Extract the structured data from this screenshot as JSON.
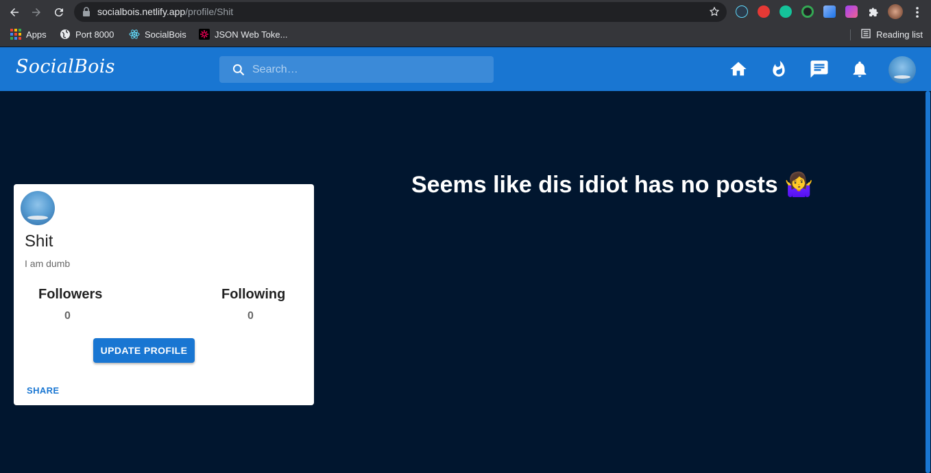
{
  "browser": {
    "url_host": "socialbois.netlify.app",
    "url_path": "/profile/Shit",
    "bookmarks": [
      "Apps",
      "Port 8000",
      "SocialBois",
      "JSON Web Toke..."
    ],
    "reading_list": "Reading list"
  },
  "appbar": {
    "brand": "SocialBois",
    "search_placeholder": "Search…",
    "nav_icons": [
      "home-icon",
      "fire-icon",
      "chat-icon",
      "bell-icon",
      "avatar"
    ],
    "color": "#1976d2"
  },
  "profile": {
    "name": "Shit",
    "bio": "I am dumb",
    "followers_label": "Followers",
    "followers_count": "0",
    "following_label": "Following",
    "following_count": "0",
    "update_button": "UPDATE PROFILE",
    "share_button": "SHARE"
  },
  "main": {
    "empty_message": "Seems like dis idiot has no posts 🤷‍♀️"
  },
  "colors": {
    "background": "#01162f",
    "accent": "#1976d2"
  }
}
